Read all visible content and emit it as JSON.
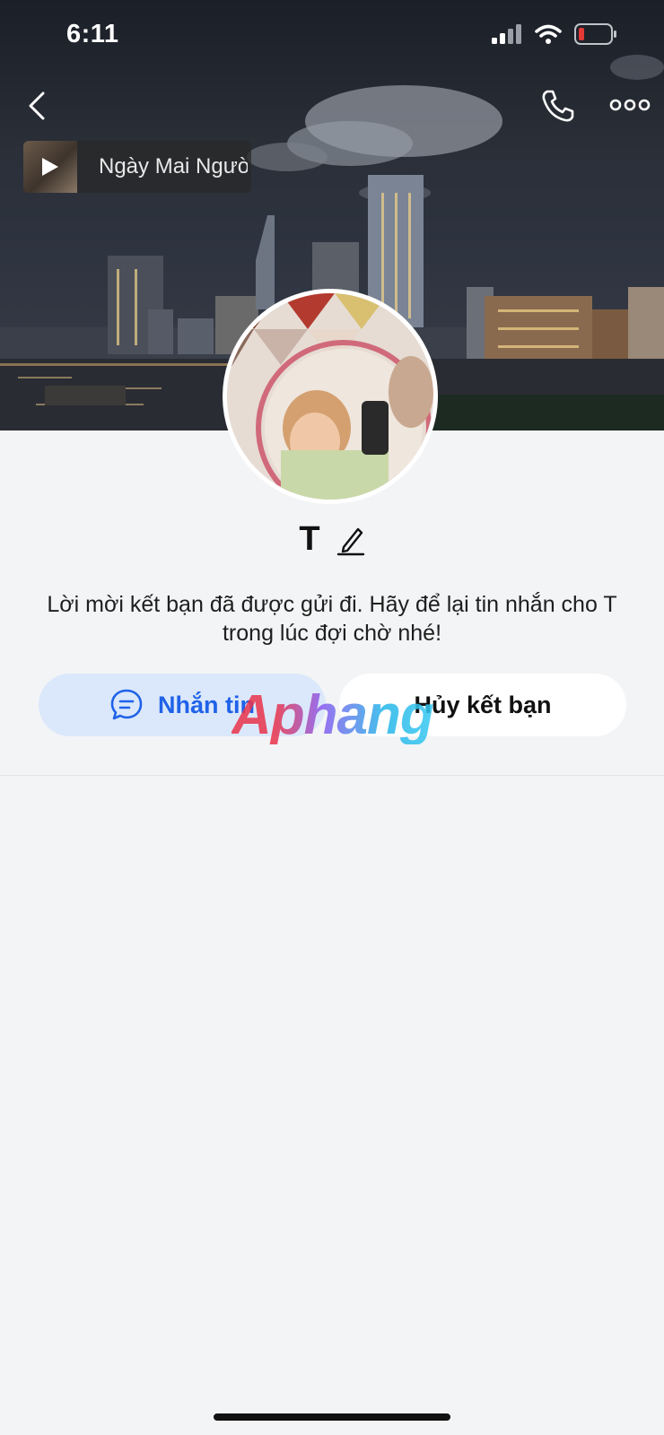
{
  "status_bar": {
    "time": "6:11"
  },
  "music": {
    "title": "Ngày Mai Ngườ"
  },
  "profile": {
    "name": "T",
    "invite_message": "Lời mời kết bạn đã được gửi đi. Hãy để lại tin nhắn cho T trong lúc đợi chờ nhé!"
  },
  "actions": {
    "message_label": "Nhắn tin",
    "cancel_label": "Hủy kết bạn"
  },
  "watermark": {
    "text": "Aphang"
  },
  "colors": {
    "accent": "#1f62e8",
    "message_button_bg": "#dbe8fb",
    "background": "#f3f4f6",
    "battery_low": "#e53935"
  },
  "icons": [
    "back-icon",
    "phone-icon",
    "more-icon",
    "play-icon",
    "edit-icon",
    "chat-icon",
    "signal-icon",
    "wifi-icon",
    "battery-icon"
  ]
}
